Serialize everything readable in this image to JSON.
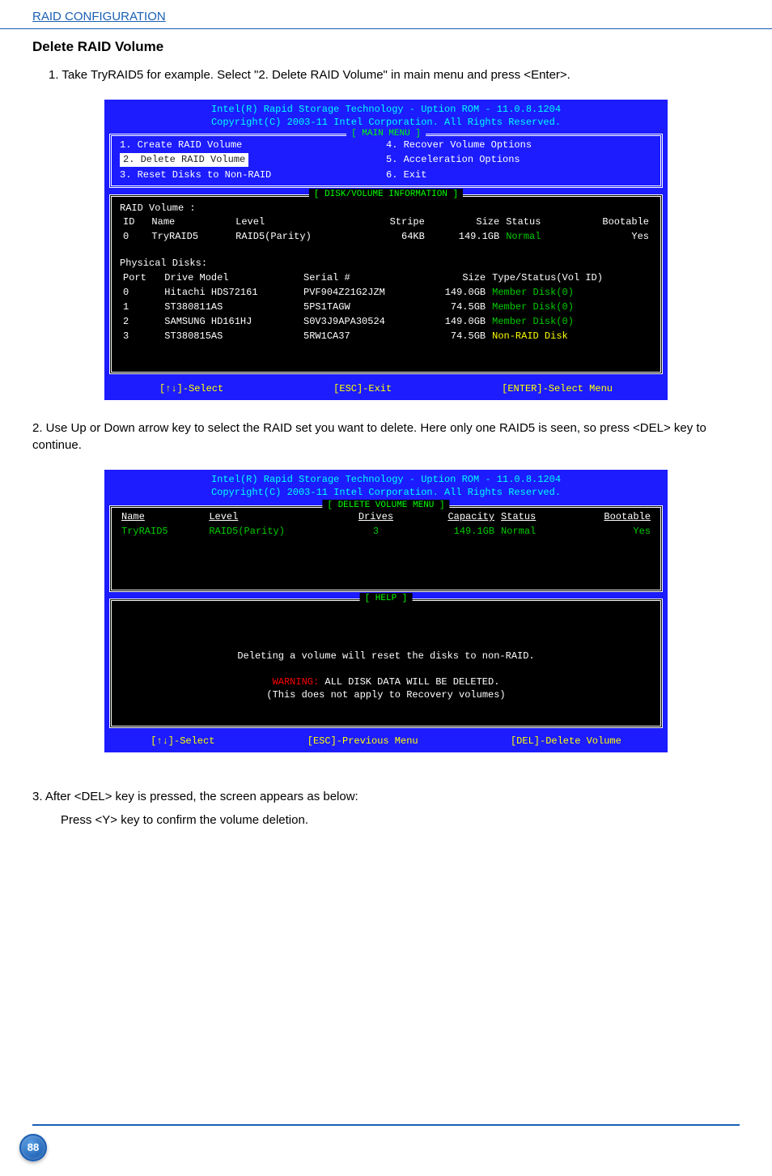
{
  "header": {
    "section": "RAID CONFIGURATION",
    "title": "Delete RAID Volume"
  },
  "step1": "1. Take TryRAID5 for example. Select \"2. Delete RAID Volume\" in main menu and press <Enter>.",
  "bios1": {
    "title1": "Intel(R) Rapid Storage Technology  -  Uption ROM - 11.0.8.1204",
    "title2": "Copyright(C) 2003-11 Intel Corporation.   All Rights Reserved.",
    "menu_frame_title": "[ MAIN MENU ]",
    "menu_left": {
      "i1": "1. Create RAID Volume",
      "i2": "2. Delete RAID Volume",
      "i3": "3. Reset Disks to Non-RAID"
    },
    "menu_right": {
      "i4": "4. Recover Volume Options",
      "i5": "5. Acceleration Options",
      "i6": "6. Exit"
    },
    "info_title": "[ DISK/VOLUME INFORMATION ]",
    "raid_vol_label": "RAID Volume :",
    "vol_headers": {
      "id": "ID",
      "name": "Name",
      "level": "Level",
      "stripe": "Stripe",
      "size": "Size",
      "status": "Status",
      "bootable": "Bootable"
    },
    "vol_row": {
      "id": "0",
      "name": "TryRAID5",
      "level": "RAID5(Parity)",
      "stripe": "64KB",
      "size": "149.1GB",
      "status": "Normal",
      "bootable": "Yes"
    },
    "phys_label": "Physical Disks:",
    "phys_headers": {
      "port": "Port",
      "model": "Drive Model",
      "serial": "Serial #",
      "size": "Size",
      "type": "Type/Status(Vol ID)"
    },
    "phys_rows": [
      {
        "port": "0",
        "model": "Hitachi HDS72161",
        "serial": "PVF904Z21G2JZM",
        "size": "149.0GB",
        "type": "Member Disk(0)"
      },
      {
        "port": "1",
        "model": "ST380811AS",
        "serial": "5PS1TAGW",
        "size": "74.5GB",
        "type": "Member Disk(0)"
      },
      {
        "port": "2",
        "model": "SAMSUNG HD161HJ",
        "serial": "S0V3J9APA30524",
        "size": "149.0GB",
        "type": "Member Disk(0)"
      },
      {
        "port": "3",
        "model": "ST380815AS",
        "serial": "5RW1CA37",
        "size": "74.5GB",
        "type": "Non-RAID Disk"
      }
    ],
    "footer": {
      "select": "[↑↓]-Select",
      "exit": "[ESC]-Exit",
      "enter": "[ENTER]-Select Menu"
    }
  },
  "step2": "2. Use Up or Down arrow key to select the RAID set you want to delete. Here only one RAID5 is  seen, so press <DEL> key to continue.",
  "bios2": {
    "title1": "Intel(R) Rapid Storage Technology  -  Uption ROM - 11.0.8.1204",
    "title2": "Copyright(C) 2003-11 Intel Corporation.   All Rights Reserved.",
    "frame_title": "[ DELETE VOLUME MENU ]",
    "headers": {
      "name": "Name",
      "level": "Level",
      "drives": "Drives",
      "capacity": "Capacity",
      "status": "Status",
      "bootable": "Bootable"
    },
    "row": {
      "name": "TryRAID5",
      "level": "RAID5(Parity)",
      "drives": "3",
      "capacity": "149.1GB",
      "status": "Normal",
      "bootable": "Yes"
    },
    "help_title": "[ HELP ]",
    "help1": "Deleting a volume will reset the disks to non-RAID.",
    "help2a": "WARNING:",
    "help2b": " ALL DISK DATA WILL BE DELETED.",
    "help3": "(This does not apply to Recovery volumes)",
    "footer": {
      "select": "[↑↓]-Select",
      "prev": "[ESC]-Previous Menu",
      "del": "[DEL]-Delete Volume"
    }
  },
  "step3a": "3. After <DEL> key is pressed, the screen appears as below:",
  "step3b": "Press <Y> key to confirm the volume deletion.",
  "page_number": "88"
}
